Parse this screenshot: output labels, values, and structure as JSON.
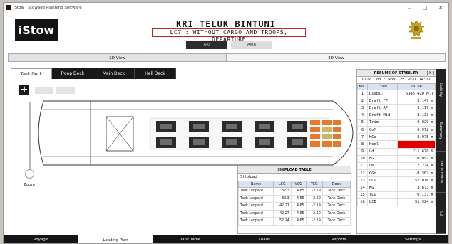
{
  "window": {
    "title": "iStow : Stowage Planning Software",
    "controls": [
      "–",
      "□",
      "✕"
    ]
  },
  "header": {
    "logo": "iStow",
    "ship_name": "KRI TELUK BINTUNI",
    "condition": "LC7 : WITHOUT CARGO AND TROOPS, DEPARTURE",
    "modes": [
      "ARI",
      "AMA"
    ],
    "emblem_icon": "navy-emblem-icon"
  },
  "view_tabs": [
    "2D View",
    "3D View"
  ],
  "deck_tabs": [
    "Tank Deck",
    "Troop Deck",
    "Main Deck",
    "Heli Deck"
  ],
  "active_deck_tab": "Tank Deck",
  "zoom_label": "Zoom",
  "plus_button": "+",
  "stability": {
    "title": "RESUME OF STABILITY",
    "toggle": "[ K ]",
    "calculated": "Calc. on : Nov, 25 2021 14:27",
    "columns": [
      "No.",
      "Item",
      "Value"
    ],
    "rows": [
      {
        "no": "1",
        "item": "Displ.",
        "value": "5345.420 M.T"
      },
      {
        "no": "2",
        "item": "Draft FP",
        "value": "3.147 m"
      },
      {
        "no": "3",
        "item": "Draft AP",
        "value": "3.119 m"
      },
      {
        "no": "4",
        "item": "Draft Mid",
        "value": "3.133 m"
      },
      {
        "no": "5",
        "item": "Trim",
        "value": "-0.029 m"
      },
      {
        "no": "6",
        "item": "GoM",
        "value": "6.972 m"
      },
      {
        "no": "7",
        "item": "KGo",
        "value": "3.975 m"
      },
      {
        "no": "8",
        "item": "Heel",
        "value": "-0.138 deg"
      },
      {
        "no": "9",
        "item": "Ld",
        "value": "211.670 %"
      },
      {
        "no": "10",
        "item": "BG",
        "value": "-0.092 m"
      },
      {
        "no": "11",
        "item": "GM",
        "value": "7.274 m"
      },
      {
        "no": "12",
        "item": "GGo",
        "value": "-0.302 m"
      },
      {
        "no": "13",
        "item": "LCG",
        "value": "52.016 m"
      },
      {
        "no": "14",
        "item": "KG",
        "value": "3.673 m"
      },
      {
        "no": "15",
        "item": "TCG",
        "value": "-0.137 m"
      },
      {
        "no": "16",
        "item": "LCB",
        "value": "51.924 m"
      }
    ]
  },
  "side_tabs": [
    "Stability",
    "Summary",
    "IMO Criteria",
    "GZ"
  ],
  "shipload": {
    "title": "SHIPLOAD TABLE",
    "label": "Shipload",
    "columns": [
      "Name",
      "LCG",
      "VCG",
      "TCG",
      "Deck"
    ],
    "rows": [
      {
        "name": "Tank Leopard",
        "lcg": "32.3",
        "vcg": "4.65",
        "tcg": "-2.19",
        "deck": "Tank Deck"
      },
      {
        "name": "Tank Leopard",
        "lcg": "32.3",
        "vcg": "4.65",
        "tcg": "2.60",
        "deck": "Tank Deck"
      },
      {
        "name": "Tank Leopard",
        "lcg": "42.27",
        "vcg": "4.65",
        "tcg": "-2.19",
        "deck": "Tank Deck"
      },
      {
        "name": "Tank Leopard",
        "lcg": "42.27",
        "vcg": "4.65",
        "tcg": "2.60",
        "deck": "Tank Deck"
      },
      {
        "name": "Tank Leopard",
        "lcg": "52.24",
        "vcg": "4.65",
        "tcg": "-2.19",
        "deck": "Tank Deck"
      }
    ]
  },
  "bottom_nav": [
    "Voyage",
    "Loading Plan",
    "Tank Table",
    "Loads",
    "Reports",
    "Settings"
  ],
  "active_nav": "Loading Plan",
  "colors": {
    "accent_red": "#c0212b",
    "alert_red": "#e00000",
    "dark": "#151515"
  }
}
